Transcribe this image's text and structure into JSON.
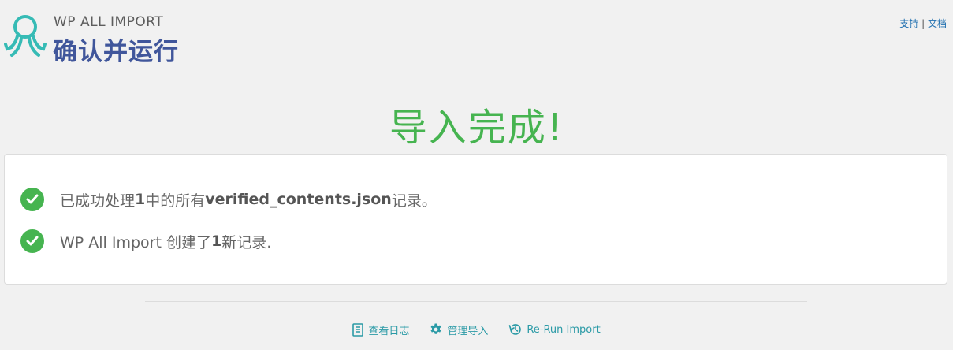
{
  "header": {
    "brand": "WP ALL IMPORT",
    "heading": "确认并运行",
    "links": {
      "support": "支持",
      "separator": "|",
      "docs": "文档"
    }
  },
  "main": {
    "title": "导入完成!",
    "messages": [
      {
        "prefix": "已成功处理",
        "count": "1",
        "middle": "中的所有",
        "file": "verified_contents.json",
        "suffix": "记录。"
      },
      {
        "prefix": "WP All Import 创建了",
        "count": "1",
        "suffix": "新记录."
      }
    ]
  },
  "footer": {
    "view_log": "查看日志",
    "manage_imports": "管理导入",
    "rerun_import": "Re-Run Import"
  },
  "colors": {
    "success": "#46b450",
    "heading": "#40569b",
    "link": "#2a9aa6",
    "logo": "#36bbb5"
  },
  "icons": [
    "octopus-logo-icon",
    "check-circle-icon",
    "document-icon",
    "gear-icon",
    "history-icon"
  ]
}
